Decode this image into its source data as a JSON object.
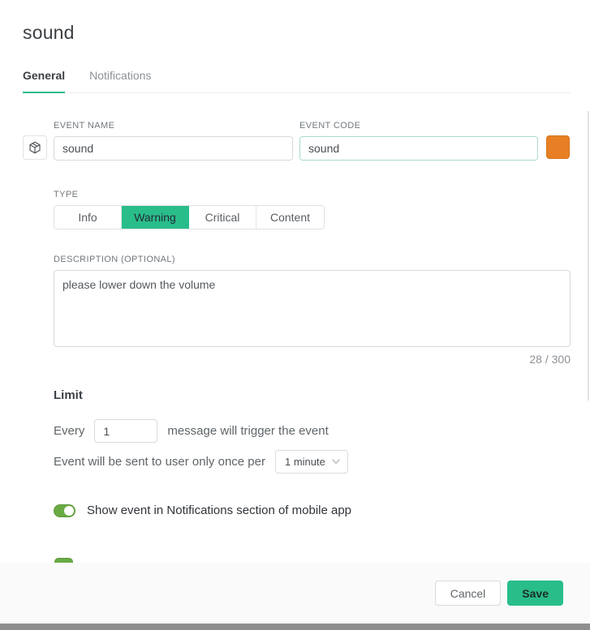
{
  "modal": {
    "title": "sound"
  },
  "tabs": {
    "general": "General",
    "notifications": "Notifications"
  },
  "form": {
    "event_name": {
      "label": "EVENT NAME",
      "value": "sound"
    },
    "event_code": {
      "label": "EVENT CODE",
      "value": "sound"
    },
    "type": {
      "label": "TYPE",
      "options": [
        "Info",
        "Warning",
        "Critical",
        "Content"
      ],
      "selected": "Warning"
    },
    "description": {
      "label": "DESCRIPTION (OPTIONAL)",
      "value": "please lower down the volume",
      "counter": "28 / 300"
    },
    "limit": {
      "heading": "Limit",
      "every_prefix": "Every",
      "every_value": "1",
      "every_suffix": "message will trigger the event",
      "once_label": "Event will be sent to user only once per",
      "once_value": "1 minute"
    },
    "toggles": {
      "show_in_notifications": {
        "label": "Show event in Notifications section of mobile app",
        "on": true
      }
    }
  },
  "footer": {
    "cancel": "Cancel",
    "save": "Save"
  },
  "icons": {
    "cube": "cube-icon",
    "chevron": "chevron-down-icon",
    "color_swatch": "color-swatch"
  },
  "colors": {
    "accent_green": "#29bd8a",
    "toggle_green": "#6aaa43",
    "swatch_orange": "#e87f24",
    "bottom_bar_gray": "#8e8e8e"
  }
}
